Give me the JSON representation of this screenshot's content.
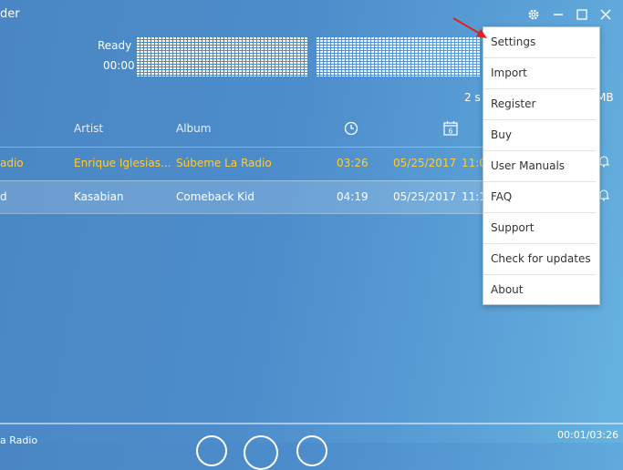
{
  "window": {
    "title_fragment": "der",
    "gear_icon": "gear-icon",
    "minimize_icon": "minimize-icon",
    "maximize_icon": "maximize-icon",
    "close_icon": "close-icon"
  },
  "status": {
    "state": "Ready",
    "time": "00:00",
    "summary": "2 s",
    "size_fragment": "MB"
  },
  "table": {
    "headers": {
      "artist": "Artist",
      "album": "Album",
      "duration_icon": "clock-icon",
      "date_icon": "calendar-icon",
      "calendar_day": "6"
    },
    "rows": [
      {
        "title": "adio",
        "artist": "Enrique Iglesias...",
        "album": "Súbeme La Radio",
        "duration": "03:26",
        "date": "05/25/2017",
        "time": "11:0",
        "highlighted": true
      },
      {
        "title": "d",
        "artist": "Kasabian",
        "album": "Comeback Kid",
        "duration": "04:19",
        "date": "05/25/2017",
        "time": "11:1",
        "highlighted": false
      }
    ]
  },
  "menu": {
    "items": [
      "Settings",
      "Import",
      "Register",
      "Buy",
      "User Manuals",
      "FAQ",
      "Support",
      "Check for updates",
      "About"
    ]
  },
  "player": {
    "now_playing": "a Radio",
    "progress": "00:01/03:26"
  },
  "colors": {
    "highlight_text": "#ffcc33",
    "arrow": "#e02020",
    "background_start": "#4a86c4",
    "background_end": "#66b3e0"
  }
}
